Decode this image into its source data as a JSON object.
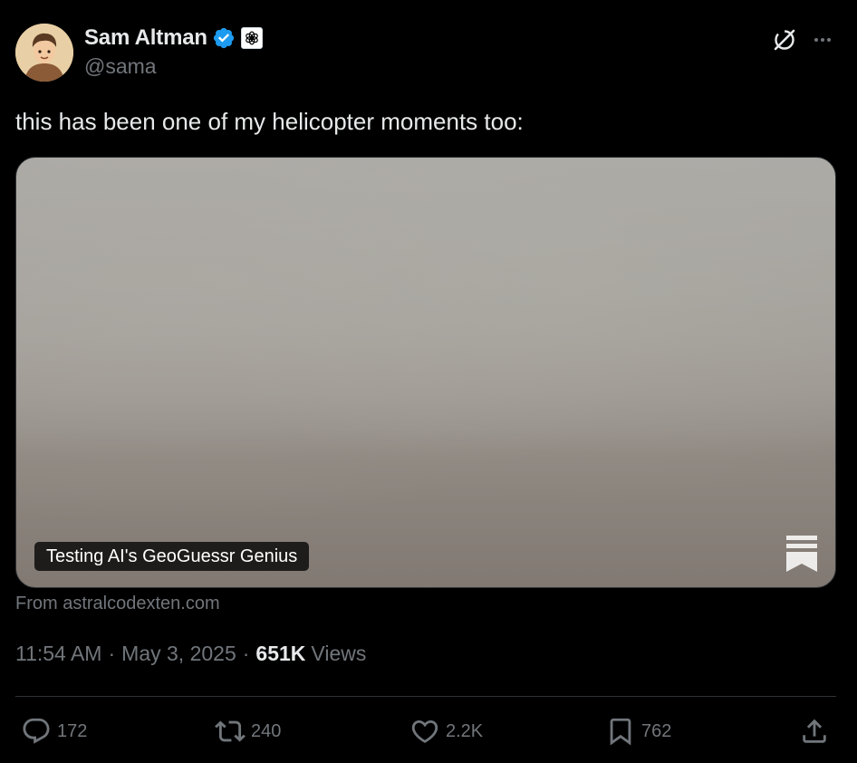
{
  "author": {
    "display_name": "Sam Altman",
    "handle": "@sama",
    "verified": true,
    "avatar_icon": "avatar-illustration",
    "affiliation_icon": "openai-logo-icon"
  },
  "tweet": {
    "text": "this has been one of my helicopter moments too:"
  },
  "card": {
    "title": "Testing AI's GeoGuessr Genius",
    "brand_icon": "substack-logo-icon",
    "source": "From astralcodexten.com"
  },
  "meta": {
    "time": "11:54 AM",
    "separator": "·",
    "date": "May 3, 2025",
    "views_count": "651K",
    "views_label": "Views"
  },
  "actions": {
    "replies": "172",
    "reposts": "240",
    "likes": "2.2K",
    "bookmarks": "762"
  },
  "colors": {
    "background": "#000000",
    "text_primary": "#e7e9ea",
    "text_secondary": "#71767b",
    "verified_blue": "#1d9bf0",
    "divider": "#2f3336"
  }
}
